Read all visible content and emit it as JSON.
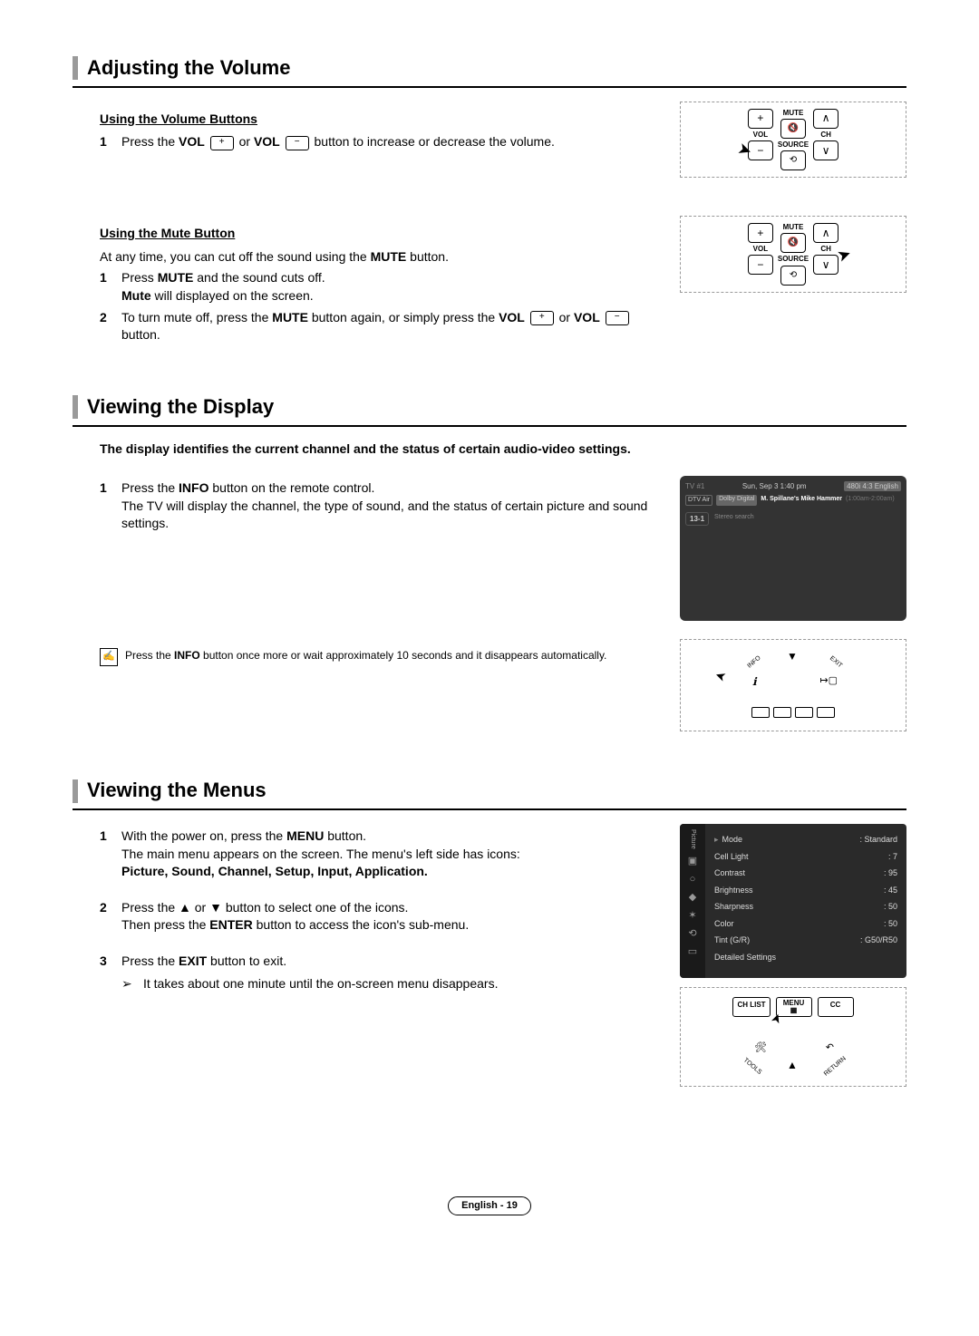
{
  "sections": {
    "volume": {
      "title": "Adjusting the Volume",
      "sub1": "Using the Volume Buttons",
      "step1": {
        "num": "1",
        "text_a": "Press the ",
        "vol": "VOL",
        "plus": "+",
        "or": " or ",
        "minus": "−",
        "text_b": " button to increase or decrease the volume."
      },
      "sub2": "Using the Mute Button",
      "sub2_intro": "At any time, you can cut off the sound using the ",
      "sub2_mute": "MUTE",
      "sub2_intro_end": " button.",
      "m_step1": {
        "num": "1",
        "a": "Press ",
        "mute": "MUTE",
        "b": " and the sound cuts off.",
        "c": "Mute",
        "d": " will displayed on the screen."
      },
      "m_step2": {
        "num": "2",
        "a": "To turn mute off, press the ",
        "mute": "MUTE",
        "b": " button again, or simply press the ",
        "vol": "VOL",
        "plus": "+",
        "or": " or ",
        "minus": "−",
        "c": " button."
      }
    },
    "display": {
      "title": "Viewing the Display",
      "intro": "The display identifies the current channel and the status of certain audio-video settings.",
      "step1": {
        "num": "1",
        "a": "Press the ",
        "info": "INFO",
        "b": " button on the remote control.",
        "c": "The TV will display the channel, the type of sound, and the status of certain picture and sound settings."
      },
      "note": {
        "a": "Press the ",
        "info": "INFO",
        "b": " button once more or wait approximately 10 seconds and it disappears automatically."
      }
    },
    "menus": {
      "title": "Viewing the Menus",
      "step1": {
        "num": "1",
        "a": "With the power on, press the ",
        "menu": "MENU",
        "b": " button.",
        "c": "The main menu appears on the screen. The menu's left side has icons: ",
        "d": "Picture, Sound, Channel, Setup, Input, Application."
      },
      "step2": {
        "num": "2",
        "a": "Press the ▲ or ▼ button to select one of the icons.",
        "b": "Then press the ",
        "enter": "ENTER",
        "c": " button to access the icon's sub-menu."
      },
      "step3": {
        "num": "3",
        "a": "Press the ",
        "exit": "EXIT",
        "b": " button to exit."
      },
      "arrow_note": "It takes about one minute until the on-screen menu disappears."
    }
  },
  "remote1": {
    "vol": "VOL",
    "mute": "MUTE",
    "source": "SOURCE",
    "ch": "CH"
  },
  "tvinfo": {
    "title": "TV #1",
    "date": "Sun, Sep 3  1:40 pm",
    "badge": "480i 4:3 English",
    "air": "DTV Air",
    "dolby": "Dolby Digital",
    "show": "M. Spillane's Mike Hammer",
    "time": "(1:00am-2:00am)",
    "ch": "13-1",
    "search": "Stereo search"
  },
  "nav1": {
    "info": "INFO",
    "exit": "EXIT"
  },
  "menu_screen": {
    "side": "Picture",
    "items": [
      {
        "label": "Mode",
        "value": ": Standard"
      },
      {
        "label": "Cell Light",
        "value": ": 7"
      },
      {
        "label": "Contrast",
        "value": ": 95"
      },
      {
        "label": "Brightness",
        "value": ": 45"
      },
      {
        "label": "Sharpness",
        "value": ": 50"
      },
      {
        "label": "Color",
        "value": ": 50"
      },
      {
        "label": "Tint (G/R)",
        "value": ": G50/R50"
      },
      {
        "label": "Detailed Settings",
        "value": ""
      }
    ]
  },
  "nav2": {
    "chlist": "CH LIST",
    "menu": "MENU",
    "cc": "CC",
    "tools": "TOOLS",
    "return": "RETURN"
  },
  "footer": "English - 19"
}
